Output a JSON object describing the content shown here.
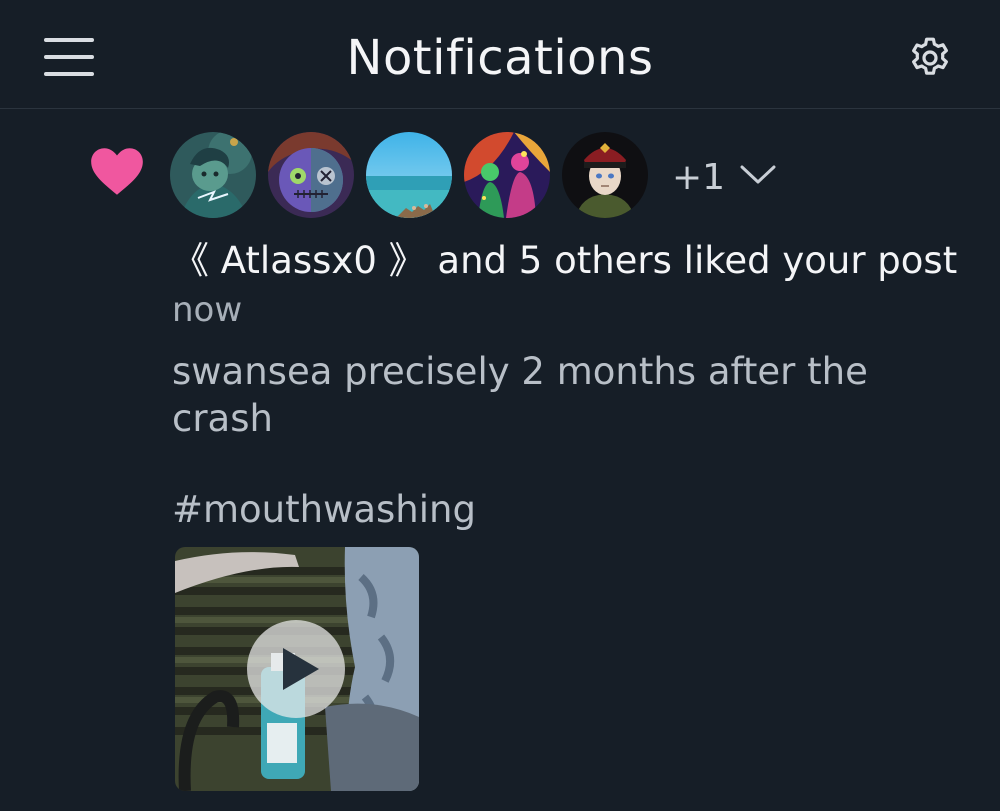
{
  "header": {
    "title": "Notifications",
    "menu_icon": "hamburger-menu-icon",
    "settings_icon": "gear-icon"
  },
  "notification": {
    "type_icon": "heart-icon",
    "accent_color": "#f0579f",
    "avatars": [
      {
        "name": "avatar-teal-character"
      },
      {
        "name": "avatar-patchwork-doll"
      },
      {
        "name": "avatar-beach"
      },
      {
        "name": "avatar-neon-figures"
      },
      {
        "name": "avatar-soldier"
      }
    ],
    "more_count": "+1",
    "expand_icon": "chevron-down-icon",
    "text": "《 Atlassx0 》 and 5 others liked your post",
    "time": "now",
    "post_text": "swansea precisely 2 months after the crash",
    "hashtag": "#mouthwashing",
    "media": {
      "type": "video",
      "play_icon": "play-icon"
    }
  },
  "colors": {
    "background": "#161e27",
    "primary_text": "#f4f5f7",
    "secondary_text": "#a7afb8"
  }
}
